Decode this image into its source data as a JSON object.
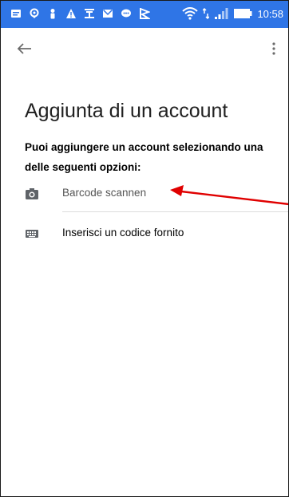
{
  "status_bar": {
    "time": "10:58",
    "icons": [
      "message-icon",
      "location-icon",
      "person-icon",
      "warning-icon",
      "app-icon",
      "mail-icon",
      "chat-icon",
      "flag-icon",
      "wifi-icon",
      "signal-icon",
      "battery-icon"
    ],
    "background_color": "#2f75e6"
  },
  "toolbar": {
    "back_icon": "arrow-left-icon",
    "menu_icon": "more-vertical-icon"
  },
  "page": {
    "title": "Aggiunta di un account",
    "subtitle": "Puoi aggiungere un account selezionando una delle seguenti opzioni:"
  },
  "options": [
    {
      "label": "Barcode scannen",
      "icon": "camera-icon"
    },
    {
      "label": "Inserisci un codice fornito",
      "icon": "keyboard-icon"
    }
  ],
  "annotation": {
    "color": "#e00000",
    "icon": "red-arrow"
  }
}
